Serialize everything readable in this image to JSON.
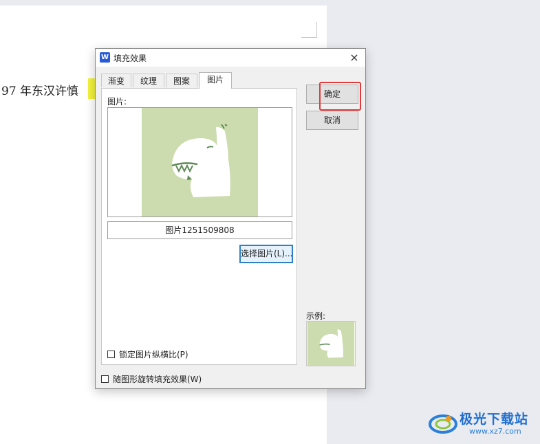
{
  "document": {
    "text": "97 年东汉许慎"
  },
  "dialog": {
    "app_icon_letter": "W",
    "title": "填充效果",
    "close_label": "×",
    "tabs": [
      {
        "label": "渐变",
        "active": false
      },
      {
        "label": "纹理",
        "active": false
      },
      {
        "label": "图案",
        "active": false
      },
      {
        "label": "图片",
        "active": true
      }
    ],
    "picture_label": "图片:",
    "picture_name": "图片1251509808",
    "select_picture_button": "选择图片(L)...",
    "lock_aspect_label": "锁定图片纵横比(P)",
    "lock_aspect_checked": false,
    "rotate_with_shape_label": "随图形旋转填充效果(W)",
    "rotate_with_shape_checked": false,
    "ok_button": "确定",
    "cancel_button": "取消",
    "sample_label": "示例:"
  },
  "colors": {
    "picture_background": "#cddcaf",
    "highlight_box": "#e03a3a",
    "focus_border": "#2f7fc5",
    "text_highlight": "#f2f23c"
  },
  "watermark": {
    "name": "极光下载站",
    "url": "www.xz7.com"
  }
}
